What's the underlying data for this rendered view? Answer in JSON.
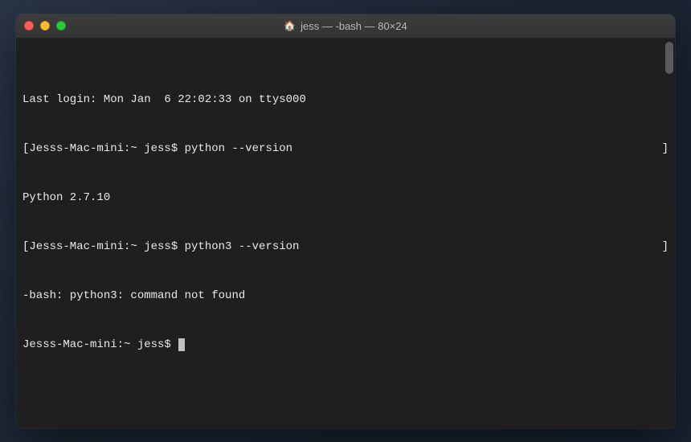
{
  "title": {
    "icon": "🏠",
    "text": "jess — -bash — 80×24"
  },
  "lines": {
    "l0": "Last login: Mon Jan  6 22:02:33 on ttys000",
    "l1_left": "[Jesss-Mac-mini:~ jess$ python --version",
    "l1_right": "]",
    "l2": "Python 2.7.10",
    "l3_left": "[Jesss-Mac-mini:~ jess$ python3 --version",
    "l3_right": "]",
    "l4": "-bash: python3: command not found",
    "l5": "Jesss-Mac-mini:~ jess$ "
  }
}
